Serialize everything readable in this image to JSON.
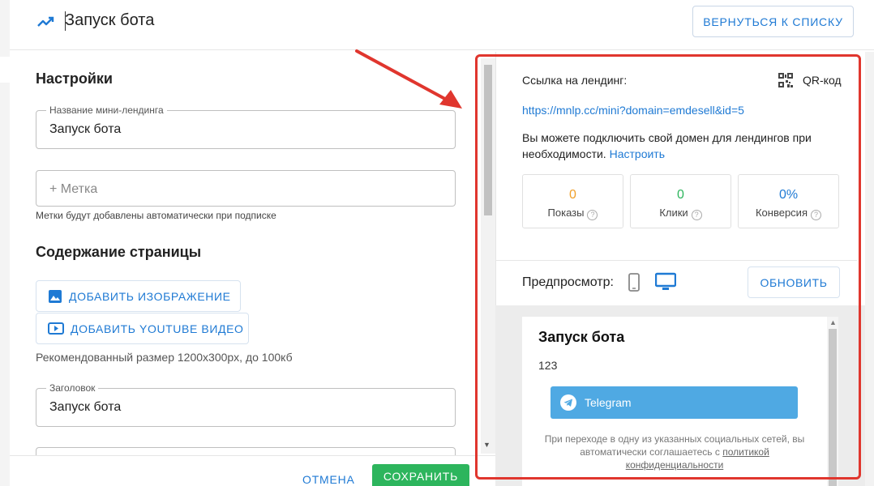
{
  "header": {
    "title": "Запуск бота",
    "back_label": "ВЕРНУТЬСЯ К СПИСКУ"
  },
  "settings": {
    "heading": "Настройки",
    "name_field": {
      "label": "Название мини-лендинга",
      "value": "Запуск бота"
    },
    "tag_field": {
      "placeholder": "+  Метка",
      "hint": "Метки будут добавлены автоматически при подписке"
    }
  },
  "content": {
    "heading": "Содержание страницы",
    "add_image_label": "ДОБАВИТЬ ИЗОБРАЖЕНИЕ",
    "add_youtube_label": "ДОБАВИТЬ YOUTUBE ВИДЕО",
    "size_hint": "Рекомендованный размер 1200x300px, до 100кб",
    "headline_field": {
      "label": "Заголовок",
      "value": "Запуск бота"
    }
  },
  "footer": {
    "cancel_label": "ОТМЕНА",
    "save_label": "СОХРАНИТЬ"
  },
  "landing": {
    "link_label": "Ссылка на лендинг:",
    "qr_label": "QR-код",
    "url": "https://mnlp.cc/mini?domain=emdesell&id=5",
    "domain_text": "Вы можете подключить свой домен для лендингов при необходимости.",
    "domain_link": "Настроить"
  },
  "stats": [
    {
      "value": "0",
      "label": "Показы",
      "color": "#f0a02a"
    },
    {
      "value": "0",
      "label": "Клики",
      "color": "#2db55d"
    },
    {
      "value": "0%",
      "label": "Конверсия",
      "color": "#1f7ad4"
    }
  ],
  "preview": {
    "label": "Предпросмотр:",
    "refresh_label": "ОБНОВИТЬ",
    "title": "Запуск бота",
    "text": "123",
    "telegram_label": "Telegram",
    "disclaimer_prefix": "При переходе в одну из указанных социальных сетей, вы автоматически соглашаетесь с",
    "disclaimer_link": "политикой конфиденциальности"
  },
  "colors": {
    "accent": "#1f7ad4",
    "save": "#2db55d",
    "highlight": "#e0362e",
    "telegram": "#4fa9e3"
  },
  "icons": {
    "trend": "trend-up-icon",
    "qr": "qr-code-icon",
    "image": "image-icon",
    "youtube": "youtube-icon",
    "phone": "phone-icon",
    "desktop": "desktop-icon",
    "telegram": "telegram-icon",
    "help": "help-icon",
    "arrow": "red-arrow-annotation"
  }
}
